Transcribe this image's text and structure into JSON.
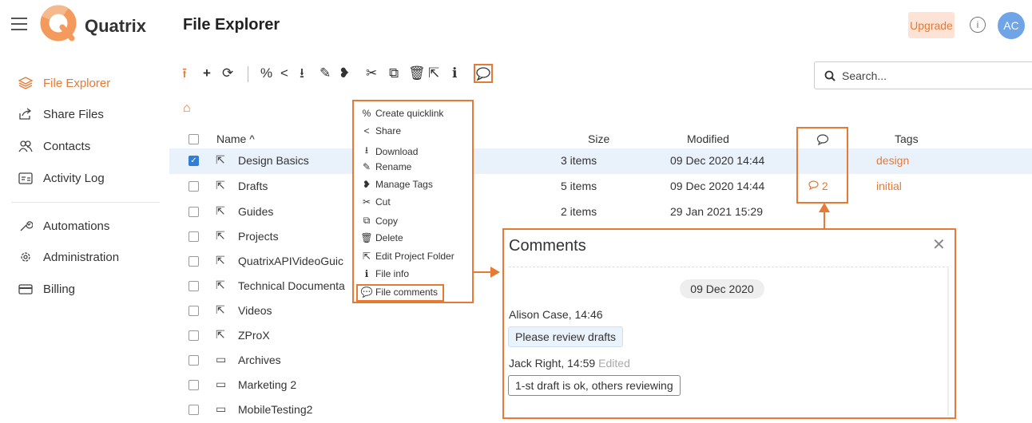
{
  "header": {
    "brand": "Quatrix",
    "page_title": "File Explorer",
    "upgrade_label": "Upgrade",
    "info_glyph": "i",
    "avatar_initials": "AC"
  },
  "sidebar": {
    "items": [
      {
        "label": "File Explorer",
        "icon": "layers-icon",
        "active": true
      },
      {
        "label": "Share Files",
        "icon": "share-icon"
      },
      {
        "label": "Contacts",
        "icon": "contacts-icon"
      },
      {
        "label": "Activity Log",
        "icon": "activity-log-icon"
      },
      {
        "label": "Automations",
        "icon": "wrench-icon"
      },
      {
        "label": "Administration",
        "icon": "admin-gear-icon"
      },
      {
        "label": "Billing",
        "icon": "card-icon"
      }
    ]
  },
  "search": {
    "placeholder": "Search..."
  },
  "table": {
    "columns": {
      "name": "Name ^",
      "size": "Size",
      "modified": "Modified",
      "comments": "comment-icon",
      "tags": "Tags"
    },
    "rows": [
      {
        "name": "Design Basics",
        "type": "project-folder",
        "size": "3 items",
        "modified": "09 Dec 2020 14:44",
        "comments": "",
        "tags": "design",
        "selected": true
      },
      {
        "name": "Drafts",
        "type": "project-folder",
        "size": "5 items",
        "modified": "09 Dec 2020 14:44",
        "comments": "2",
        "tags": "initial"
      },
      {
        "name": "Guides",
        "type": "project-folder",
        "size": "2 items",
        "modified": "29 Jan 2021 15:29",
        "comments": "",
        "tags": ""
      },
      {
        "name": "Projects",
        "type": "project-folder",
        "size": "",
        "modified": "",
        "comments": "",
        "tags": ""
      },
      {
        "name": "QuatrixAPIVideoGuic",
        "type": "project-folder",
        "size": "",
        "modified": "",
        "comments": "",
        "tags": ""
      },
      {
        "name": "Technical Documenta",
        "type": "project-folder",
        "size": "",
        "modified": "",
        "comments": "",
        "tags": ""
      },
      {
        "name": "Videos",
        "type": "project-folder",
        "size": "",
        "modified": "",
        "comments": "",
        "tags": ""
      },
      {
        "name": "ZProX",
        "type": "project-folder",
        "size": "",
        "modified": "",
        "comments": "",
        "tags": ""
      },
      {
        "name": "Archives",
        "type": "folder",
        "size": "",
        "modified": "",
        "comments": "",
        "tags": ""
      },
      {
        "name": "Marketing 2",
        "type": "folder",
        "size": "",
        "modified": "",
        "comments": "",
        "tags": ""
      },
      {
        "name": "MobileTesting2",
        "type": "folder",
        "size": "",
        "modified": "",
        "comments": "",
        "tags": ""
      }
    ]
  },
  "context_menu": {
    "items": [
      {
        "label": "Create quicklink",
        "icon": "link-icon"
      },
      {
        "label": "Share",
        "icon": "share-icon"
      },
      {
        "label": "Download",
        "icon": "download-icon"
      },
      {
        "label": "Rename",
        "icon": "pencil-icon"
      },
      {
        "label": "Manage Tags",
        "icon": "tags-icon"
      },
      {
        "label": "Cut",
        "icon": "scissors-icon"
      },
      {
        "label": "Copy",
        "icon": "copy-icon"
      },
      {
        "label": "Delete",
        "icon": "trash-icon"
      },
      {
        "label": "Edit Project Folder",
        "icon": "edit-folder-icon"
      },
      {
        "label": "File info",
        "icon": "info-icon"
      },
      {
        "label": "File comments",
        "icon": "comment-icon"
      }
    ]
  },
  "comments": {
    "title": "Comments",
    "date": "09 Dec 2020",
    "entries": [
      {
        "author": "Alison Case, 14:46",
        "edited": "",
        "text": "Please review drafts"
      },
      {
        "author": "Jack Right, 14:59",
        "edited": "Edited",
        "text": "1-st draft is ok, others reviewing"
      }
    ]
  },
  "colors": {
    "accent": "#e67a35",
    "selected_row": "#e9f1fb",
    "avatar": "#6fa4e6",
    "upgrade_bg": "#fde3d6"
  }
}
